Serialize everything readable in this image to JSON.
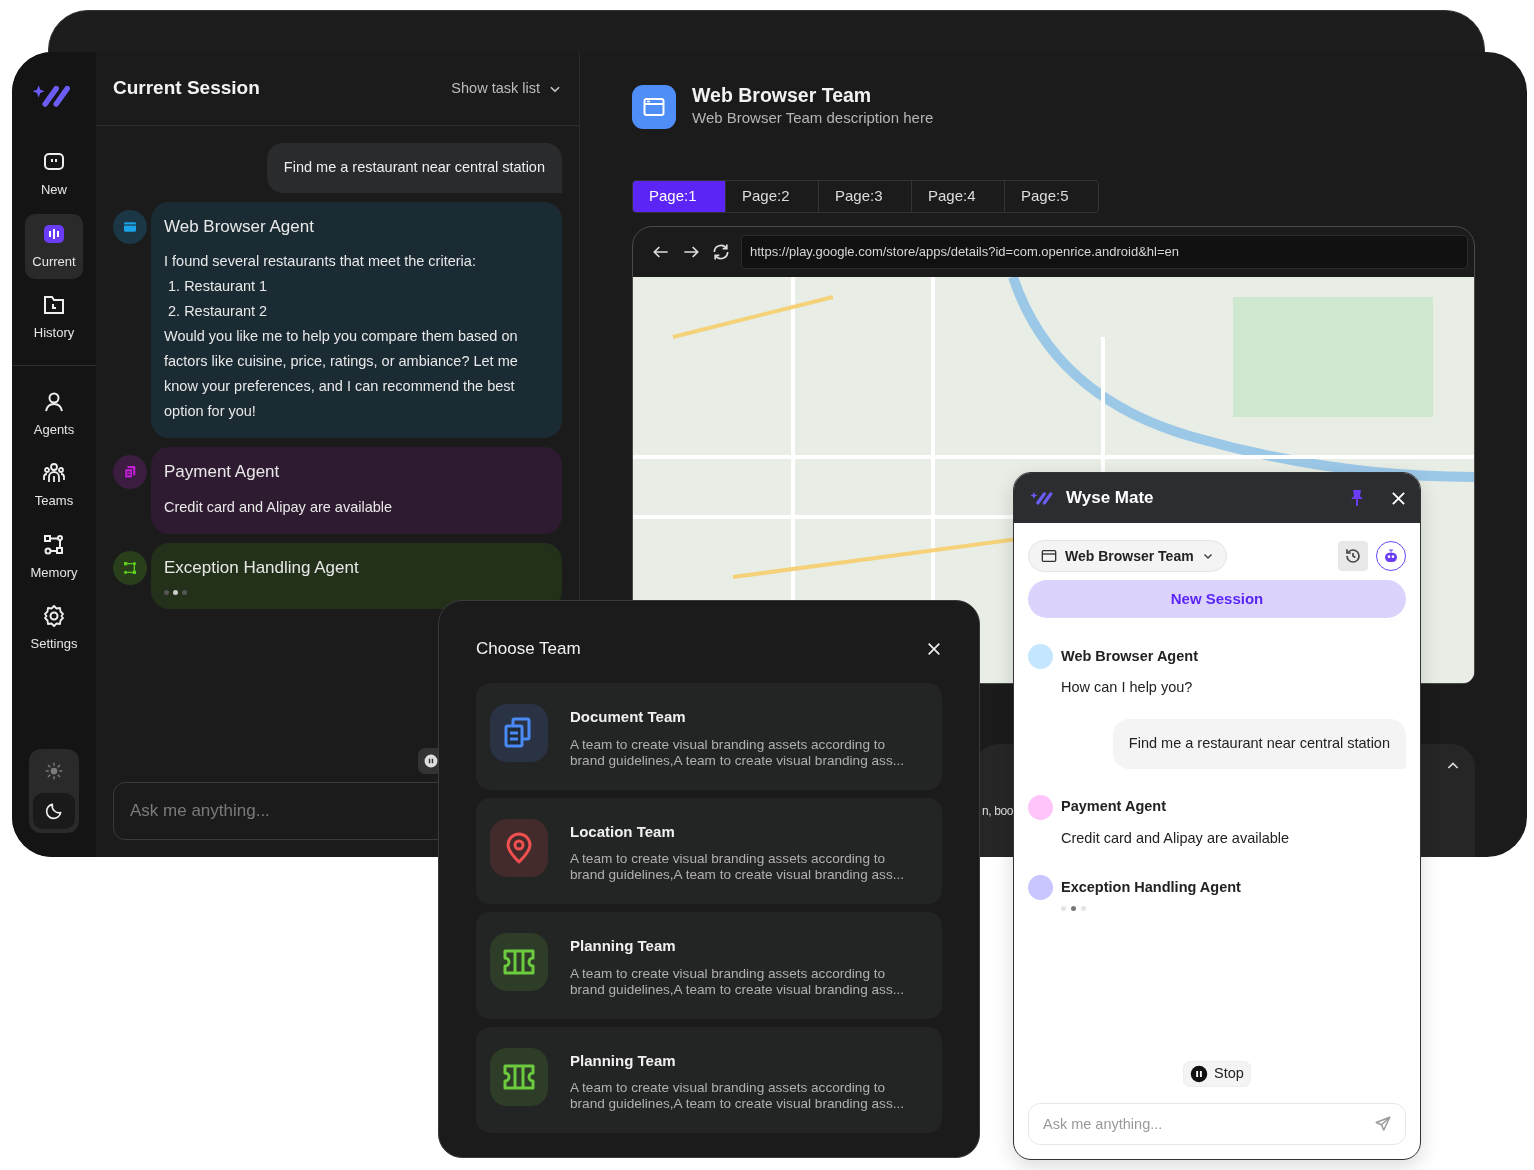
{
  "app": {
    "sidebar": {
      "top": [
        {
          "label": "New",
          "kind": "new",
          "selected": false
        },
        {
          "label": "Current",
          "kind": "current",
          "selected": true
        },
        {
          "label": "History",
          "kind": "history",
          "selected": false
        }
      ],
      "bottom": [
        {
          "label": "Agents",
          "kind": "agents",
          "selected": false
        },
        {
          "label": "Teams",
          "kind": "teams",
          "selected": false
        },
        {
          "label": "Memory",
          "kind": "memory",
          "selected": false
        },
        {
          "label": "Settings",
          "kind": "settings",
          "selected": false
        }
      ],
      "theme": [
        {
          "kind": "light",
          "selected": false
        },
        {
          "kind": "dark",
          "selected": true
        }
      ]
    },
    "session": {
      "title": "Current Session",
      "task_toggle": "Show task list",
      "messages": [
        {
          "kind": "user",
          "text": "Find me a restaurant near central station"
        },
        {
          "kind": "agent",
          "color": "#1aa3e8",
          "name": "Web Browser Agent",
          "lines": [
            "I found several restaurants that meet the criteria:",
            " 1. Restaurant 1",
            " 2. Restaurant 2",
            "Would you like me to help you compare them based on factors like cuisine, price, ratings, or ambiance? Let me know your preferences, and I can recommend the best option for you!"
          ],
          "typing": false
        },
        {
          "kind": "agent",
          "color": "#c21fd6",
          "name": "Payment Agent",
          "lines": [
            "Credit card and Alipay are available"
          ],
          "typing": false
        },
        {
          "kind": "agent",
          "color": "#5fcf1d",
          "name": "Exception Handling Agent",
          "typing": true
        }
      ],
      "input": {
        "placeholder": "Ask me anything..."
      }
    },
    "team": {
      "name": "Web Browser Team",
      "description": "Web Browser Team description here",
      "tabs": [
        {
          "label": "Page:1",
          "selected": true
        },
        {
          "label": "Page:2",
          "selected": false
        },
        {
          "label": "Page:3",
          "selected": false
        },
        {
          "label": "Page:4",
          "selected": false
        },
        {
          "label": "Page:5",
          "selected": false
        }
      ],
      "url": "https://play.google.com/store/apps/details?id=com.openrice.android&hl=en",
      "input_fragment": "n, boo"
    }
  },
  "choose_team": {
    "title": "Choose Team",
    "teams": [
      {
        "kind": "docs",
        "color": "#4a8af4",
        "name": "Document Team",
        "description": "A team to create visual branding assets according to brand guidelines,A team to create visual branding ass..."
      },
      {
        "kind": "location",
        "color": "#f0504f",
        "name": "Location Team",
        "description": "A team to create visual branding assets according to brand guidelines,A team to create visual branding ass..."
      },
      {
        "kind": "planning",
        "color": "#6ccb3f",
        "name": "Planning Team",
        "description": "A team to create visual branding assets according to brand guidelines,A team to create visual branding ass..."
      },
      {
        "kind": "planning",
        "color": "#6ccb3f",
        "name": "Planning Team",
        "description": "A team to create visual branding assets according to brand guidelines,A team to create visual branding ass..."
      }
    ]
  },
  "mate": {
    "title": "Wyse Mate",
    "pinned": true,
    "team": "Web Browser Team",
    "new_session": "New Session",
    "messages": [
      {
        "kind": "agent",
        "color": "#c5e6ff",
        "name": "Web Browser Agent",
        "text": "How can I help you?",
        "typing": false
      },
      {
        "kind": "user",
        "text": "Find me a restaurant near central station"
      },
      {
        "kind": "agent",
        "color": "#ffc4fa",
        "name": "Payment Agent",
        "text": "Credit card and Alipay are available",
        "typing": false
      },
      {
        "kind": "agent",
        "color": "#c9c5ff",
        "name": "Exception Handling Agent",
        "typing": true
      }
    ],
    "stop": "Stop",
    "input": {
      "placeholder": "Ask me anything..."
    }
  }
}
